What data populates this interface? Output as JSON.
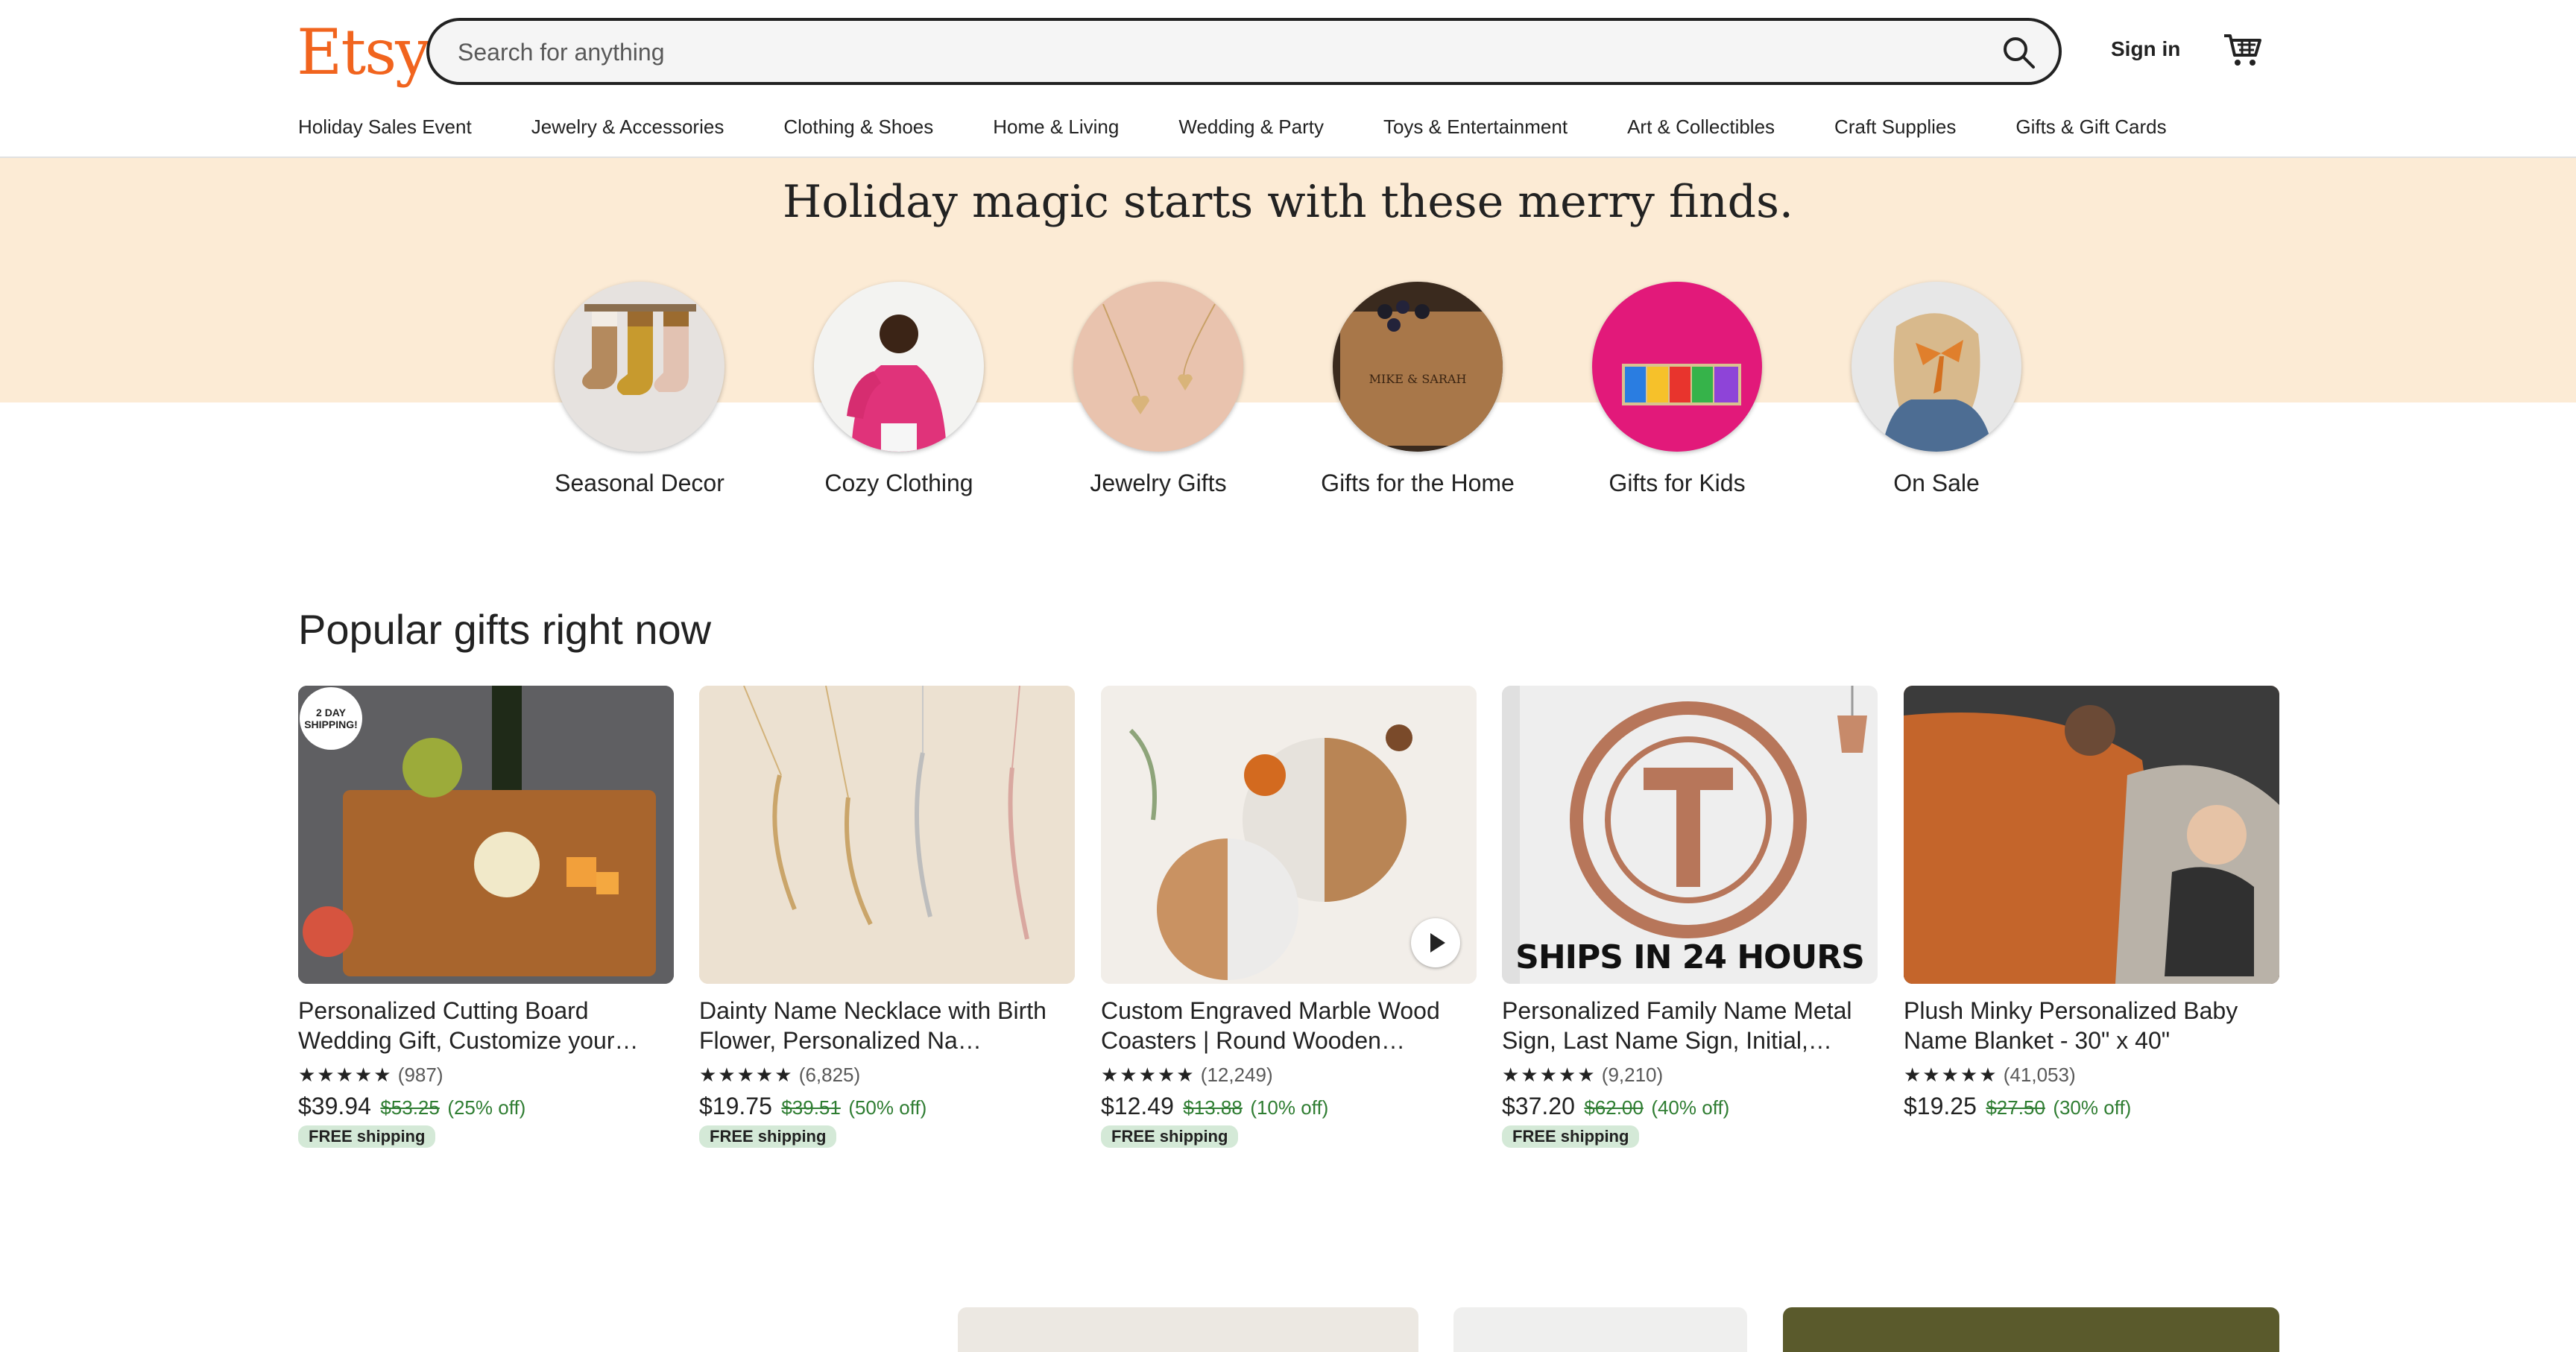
{
  "header": {
    "logo": "Etsy",
    "search_placeholder": "Search for anything",
    "sign_in": "Sign in",
    "accent_color": "#f1641e"
  },
  "nav": [
    "Holiday Sales Event",
    "Jewelry & Accessories",
    "Clothing & Shoes",
    "Home & Living",
    "Wedding & Party",
    "Toys & Entertainment",
    "Art & Collectibles",
    "Craft Supplies",
    "Gifts & Gift Cards"
  ],
  "banner": {
    "title": "Holiday magic starts with these merry finds.",
    "background": "#fcebd5",
    "categories": [
      {
        "label": "Seasonal Decor",
        "icon": "stockings-image"
      },
      {
        "label": "Cozy Clothing",
        "icon": "sweater-image"
      },
      {
        "label": "Jewelry Gifts",
        "icon": "necklace-image"
      },
      {
        "label": "Gifts for the Home",
        "icon": "cutting-board-image"
      },
      {
        "label": "Gifts for Kids",
        "icon": "name-puzzle-image"
      },
      {
        "label": "On Sale",
        "icon": "hair-bow-image"
      }
    ]
  },
  "popular": {
    "title": "Popular gifts right now",
    "items": [
      {
        "title": "Personalized Cutting Board Wedding Gift, Customize your…",
        "stars": "★★★★★",
        "reviews": "(987)",
        "price": "$39.94",
        "original": "$53.25",
        "discount": "(25% off)",
        "shipping": "FREE shipping",
        "badge": "2 DAY SHIPPING!"
      },
      {
        "title": "Dainty Name Necklace with Birth Flower, Personalized Na…",
        "stars": "★★★★★",
        "reviews": "(6,825)",
        "price": "$19.75",
        "original": "$39.51",
        "discount": "(50% off)",
        "shipping": "FREE shipping"
      },
      {
        "title": "Custom Engraved Marble Wood Coasters | Round Wooden…",
        "stars": "★★★★★",
        "reviews": "(12,249)",
        "price": "$12.49",
        "original": "$13.88",
        "discount": "(10% off)",
        "shipping": "FREE shipping"
      },
      {
        "title": "Personalized Family Name Metal Sign, Last Name Sign, Initial,…",
        "stars": "★★★★★",
        "reviews": "(9,210)",
        "price": "$37.20",
        "original": "$62.00",
        "discount": "(40% off)",
        "shipping": "FREE shipping",
        "overlay": "SHIPS IN 24 HOURS"
      },
      {
        "title": "Plush Minky Personalized Baby Name Blanket - 30\" x 40\"",
        "stars": "★★★★★",
        "reviews": "(41,053)",
        "price": "$19.25",
        "original": "$27.50",
        "discount": "(30% off)",
        "shipping": ""
      }
    ]
  }
}
